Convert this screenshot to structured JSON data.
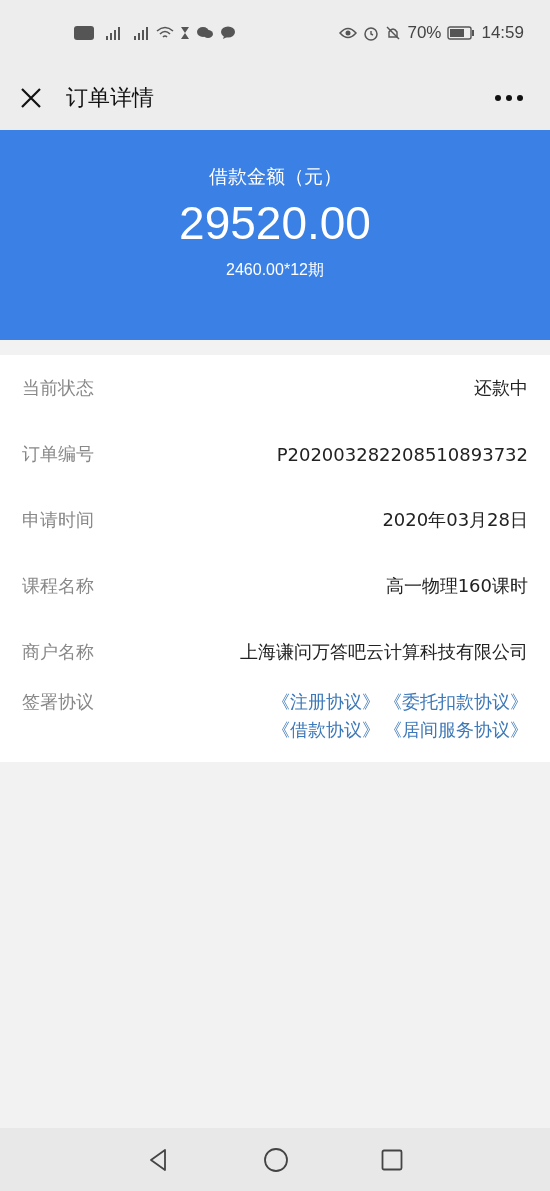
{
  "status_bar": {
    "battery": "70%",
    "time": "14:59"
  },
  "header": {
    "title": "订单详情"
  },
  "summary": {
    "label": "借款金额（元）",
    "amount": "29520.00",
    "installments": "2460.00*12期"
  },
  "details": [
    {
      "label": "当前状态",
      "value": "还款中"
    },
    {
      "label": "订单编号",
      "value": "P202003282208510893732"
    },
    {
      "label": "申请时间",
      "value": "2020年03月28日"
    },
    {
      "label": "课程名称",
      "value": "高一物理160课时"
    },
    {
      "label": "商户名称",
      "value": "上海谦问万答吧云计算科技有限公司"
    }
  ],
  "agreements": {
    "label": "签署协议",
    "links": [
      "《注册协议》",
      "《委托扣款协议》",
      "《借款协议》",
      "《居间服务协议》"
    ]
  }
}
